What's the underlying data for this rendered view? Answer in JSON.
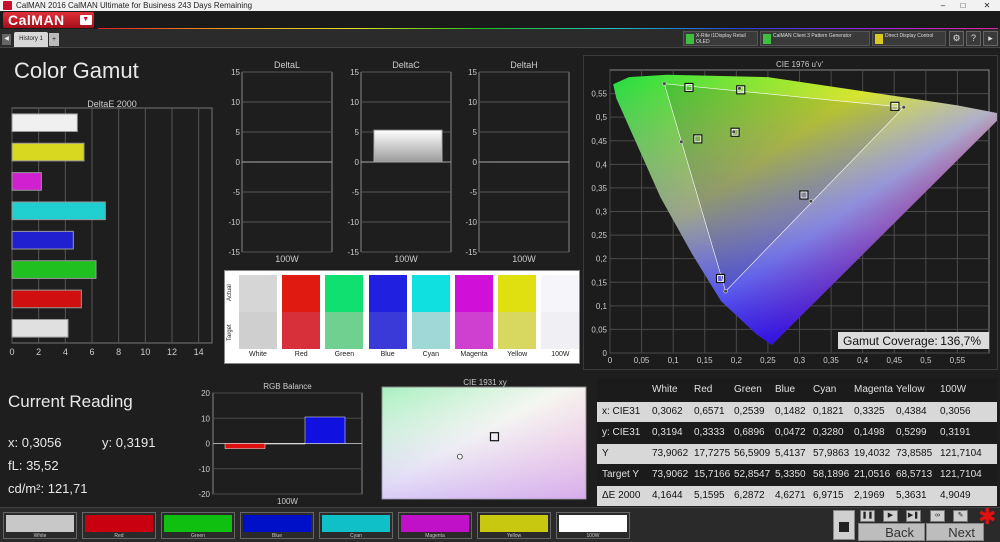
{
  "window": {
    "title": "CalMAN 2016 CalMAN Ultimate for Business 243 Days Remaining",
    "brand": "CalMAN"
  },
  "tabs": [
    {
      "label": "History 1"
    }
  ],
  "devices": [
    {
      "line1": "X-Rite i1Display Retail",
      "line2": "OLED"
    },
    {
      "line1": "CalMAN Client 3 Pattern Generator"
    },
    {
      "line1": "Direct Display Control"
    }
  ],
  "page": {
    "title": "Color Gamut"
  },
  "nav": {
    "back": "Back",
    "next": "Next"
  },
  "reading": {
    "title": "Current Reading",
    "x": "x: 0,3056",
    "y": "y: 0,3191",
    "fl": "fL: 35,52",
    "cdm2": "cd/m²: 121,71"
  },
  "colors": {
    "White": "#f2f2f2",
    "Red": "#e01010",
    "Green": "#10d040",
    "Blue": "#1010d8",
    "Cyan": "#10d0d0",
    "Magenta": "#d010d0",
    "Yellow": "#d8d810",
    "100W": "#ffffff",
    "panel_bg": "#1c1c1c",
    "grid": "#555555"
  },
  "swatches": {
    "actual_label": "Actual",
    "target_label": "Target",
    "items": [
      {
        "label": "White",
        "actual": "#d6d6d6",
        "target": "#cfcfcf"
      },
      {
        "label": "Red",
        "actual": "#e01a10",
        "target": "#d8303a"
      },
      {
        "label": "Green",
        "actual": "#10e070",
        "target": "#70d090"
      },
      {
        "label": "Blue",
        "actual": "#2020e0",
        "target": "#3a3ad8"
      },
      {
        "label": "Cyan",
        "actual": "#10e0e0",
        "target": "#a0d8d8"
      },
      {
        "label": "Magenta",
        "actual": "#d010d8",
        "target": "#d040d0"
      },
      {
        "label": "Yellow",
        "actual": "#e0e010",
        "target": "#d8d860"
      },
      {
        "label": "100W",
        "actual": "#f6f6fa",
        "target": "#f0f0f4"
      }
    ]
  },
  "bottom_swatches": [
    {
      "label": "White",
      "color": "#c8c8c8"
    },
    {
      "label": "Red",
      "color": "#c80010"
    },
    {
      "label": "Green",
      "color": "#10c010"
    },
    {
      "label": "Blue",
      "color": "#0010c8"
    },
    {
      "label": "Cyan",
      "color": "#10c0c8"
    },
    {
      "label": "Magenta",
      "color": "#c010c8"
    },
    {
      "label": "Yellow",
      "color": "#c8c810"
    },
    {
      "label": "100W",
      "color": "#ffffff"
    }
  ],
  "table": {
    "headers": [
      "",
      "White",
      "Red",
      "Green",
      "Blue",
      "Cyan",
      "Magenta",
      "Yellow",
      "100W"
    ],
    "rows": [
      {
        "label": "x: CIE31",
        "values": [
          "0,3062",
          "0,6571",
          "0,2539",
          "0,1482",
          "0,1821",
          "0,3325",
          "0,4384",
          "0,3056"
        ]
      },
      {
        "label": "y: CIE31",
        "values": [
          "0,3194",
          "0,3333",
          "0,6896",
          "0,0472",
          "0,3280",
          "0,1498",
          "0,5299",
          "0,3191"
        ]
      },
      {
        "label": "Y",
        "values": [
          "73,9062",
          "17,7275",
          "56,5909",
          "5,4137",
          "57,9863",
          "19,4032",
          "73,8585",
          "121,7104"
        ]
      },
      {
        "label": "Target Y",
        "values": [
          "73,9062",
          "15,7166",
          "52,8547",
          "5,3350",
          "58,1896",
          "21,0516",
          "68,5713",
          "121,7104"
        ]
      },
      {
        "label": "ΔE 2000",
        "values": [
          "4,1644",
          "5,1595",
          "6,2872",
          "4,6271",
          "6,9715",
          "2,1969",
          "5,3631",
          "4,9049"
        ]
      }
    ]
  },
  "chart_data": [
    {
      "type": "bar",
      "title": "DeltaE 2000",
      "orientation": "horizontal",
      "categories": [
        "White",
        "Yellow",
        "Magenta",
        "Cyan",
        "Blue",
        "Green",
        "Red",
        "Gray"
      ],
      "values": [
        4.9,
        5.4,
        2.2,
        7.0,
        4.6,
        6.3,
        5.2,
        4.2
      ],
      "colors": [
        "#f0f0f0",
        "#d8d820",
        "#d020d0",
        "#20d0d0",
        "#2020d0",
        "#20c020",
        "#d01010",
        "#e0e0e0"
      ],
      "xlim": [
        0,
        15
      ],
      "xticks": [
        "0",
        "2",
        "4",
        "6",
        "8",
        "10",
        "12",
        "14"
      ]
    },
    {
      "type": "bar",
      "title": "DeltaL",
      "categories": [
        "100W"
      ],
      "values": [
        0
      ],
      "ylim": [
        -15,
        15
      ],
      "yticks": [
        "15",
        "10",
        "5",
        "0",
        "-5",
        "-10",
        "-15"
      ]
    },
    {
      "type": "bar",
      "title": "DeltaC",
      "categories": [
        "100W"
      ],
      "values": [
        5.3
      ],
      "ylim": [
        -15,
        15
      ],
      "yticks": [
        "15",
        "10",
        "5",
        "0",
        "-5",
        "-10",
        "-15"
      ]
    },
    {
      "type": "bar",
      "title": "DeltaH",
      "categories": [
        "100W"
      ],
      "values": [
        0
      ],
      "ylim": [
        -15,
        15
      ],
      "yticks": [
        "15",
        "10",
        "5",
        "0",
        "-5",
        "-10",
        "-15"
      ]
    },
    {
      "type": "bar",
      "title": "RGB Balance",
      "categories": [
        "100W"
      ],
      "series": [
        {
          "name": "Red",
          "values": [
            -2
          ]
        },
        {
          "name": "Green",
          "values": [
            0
          ]
        },
        {
          "name": "Blue",
          "values": [
            10.5
          ]
        }
      ],
      "ylim": [
        -20,
        20
      ],
      "yticks": [
        "20",
        "10",
        "0",
        "-10",
        "-20"
      ]
    },
    {
      "type": "scatter",
      "title": "CIE 1976 u'v'",
      "xlim": [
        0,
        0.6
      ],
      "ylim": [
        0,
        0.6
      ],
      "xticks": [
        "0",
        "0,05",
        "0,1",
        "0,15",
        "0,2",
        "0,25",
        "0,3",
        "0,35",
        "0,4",
        "0,45",
        "0,5",
        "0,55"
      ],
      "yticks": [
        "0",
        "0,05",
        "0,1",
        "0,15",
        "0,2",
        "0,25",
        "0,3",
        "0,35",
        "0,4",
        "0,45",
        "0,5",
        "0,55"
      ],
      "targets": [
        {
          "name": "Red",
          "u": 0.451,
          "v": 0.523
        },
        {
          "name": "Green",
          "u": 0.125,
          "v": 0.563
        },
        {
          "name": "Blue",
          "u": 0.175,
          "v": 0.158
        },
        {
          "name": "Cyan",
          "u": 0.139,
          "v": 0.454
        },
        {
          "name": "Magenta",
          "u": 0.307,
          "v": 0.335
        },
        {
          "name": "Yellow",
          "u": 0.207,
          "v": 0.558
        },
        {
          "name": "White",
          "u": 0.198,
          "v": 0.468
        }
      ],
      "measured": [
        {
          "name": "Red",
          "u": 0.465,
          "v": 0.521
        },
        {
          "name": "Green",
          "u": 0.086,
          "v": 0.571
        },
        {
          "name": "Blue",
          "u": 0.183,
          "v": 0.131
        },
        {
          "name": "Cyan",
          "u": 0.113,
          "v": 0.448
        },
        {
          "name": "Magenta",
          "u": 0.318,
          "v": 0.322
        },
        {
          "name": "Yellow",
          "u": 0.205,
          "v": 0.561
        },
        {
          "name": "White",
          "u": 0.196,
          "v": 0.469
        }
      ],
      "gamut_coverage_label": "Gamut Coverage:",
      "gamut_coverage_value": "136,7%"
    },
    {
      "type": "scatter",
      "title": "CIE 1931 xy",
      "points": [
        {
          "name": "Target",
          "x": 0.3127,
          "y": 0.329
        },
        {
          "name": "Measured",
          "x": 0.3056,
          "y": 0.3191
        }
      ]
    }
  ]
}
